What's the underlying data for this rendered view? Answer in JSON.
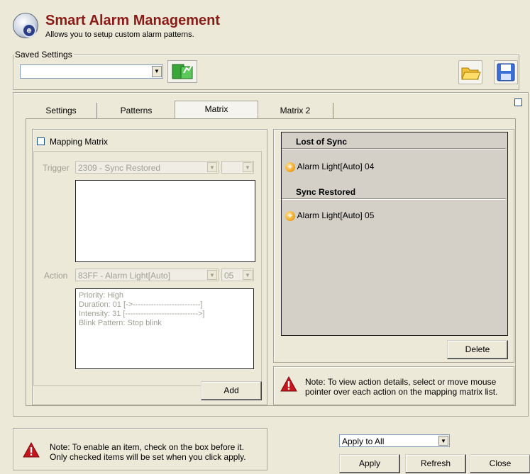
{
  "header": {
    "title": "Smart Alarm Management",
    "subtitle": "Allows you to setup custom alarm patterns."
  },
  "saved_settings": {
    "label": "Saved Settings",
    "value": ""
  },
  "tabs": [
    {
      "label": "Settings"
    },
    {
      "label": "Patterns"
    },
    {
      "label": "Matrix"
    },
    {
      "label": "Matrix 2"
    }
  ],
  "matrix": {
    "mapping_label": "Mapping Matrix",
    "trigger_label": "Trigger",
    "trigger_value": "2309 - Sync Restored",
    "trigger_sub_value": "",
    "action_label": "Action",
    "action_value": "83FF - Alarm Light[Auto]",
    "action_sub_value": "05",
    "details": [
      "Priority: High",
      "Duration: 01 [->--------------------------]",
      "Intensity: 31 [---------------------------->]",
      "Blink Pattern:  Stop blink"
    ],
    "add_label": "Add"
  },
  "mapping_list": {
    "groups": [
      {
        "header": "Lost of Sync",
        "items": [
          "Alarm Light[Auto] 04"
        ]
      },
      {
        "header": "Sync Restored",
        "items": [
          "Alarm Light[Auto] 05"
        ]
      }
    ],
    "delete_label": "Delete",
    "note_line1": "Note: To view action details, select or move mouse",
    "note_line2": "pointer over each action on the mapping matrix list."
  },
  "footer": {
    "note_line1": "Note: To enable an item, check on the box before it.",
    "note_line2": "Only checked items will be set when you click apply.",
    "apply_scope": "Apply to All",
    "apply_label": "Apply",
    "refresh_label": "Refresh",
    "close_label": "Close"
  },
  "colors": {
    "title": "#8a1b17",
    "window_bg": "#ece9d8",
    "list_bg": "#d4d0c8",
    "warning": "#c4161c"
  },
  "icons": [
    "app-logo-icon",
    "apply-saved-icon",
    "open-folder-icon",
    "save-disk-icon",
    "warning-icon",
    "plus-circle-icon",
    "chevron-down-icon"
  ]
}
